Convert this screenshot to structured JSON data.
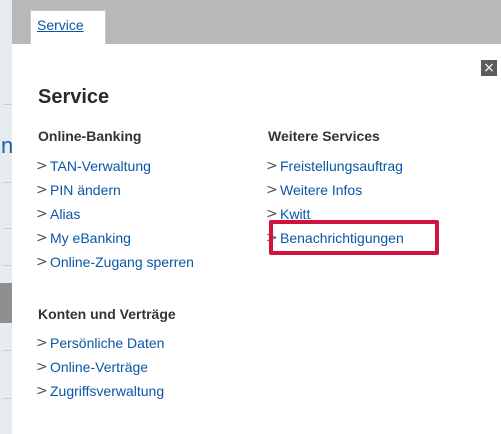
{
  "tabs": {
    "service_label": "Service"
  },
  "close": {
    "glyph": "×",
    "icon_name": "close-icon"
  },
  "panel": {
    "title": "Service",
    "columns": [
      {
        "title": "Online-Banking",
        "links": [
          "TAN-Verwaltung",
          "PIN ändern",
          "Alias",
          "My eBanking",
          "Online-Zugang sperren"
        ]
      },
      {
        "title": "Weitere Services",
        "links": [
          "Freistellungsauftrag",
          "Weitere Infos",
          "Kwitt",
          "Benachrichtigungen"
        ]
      },
      {
        "title": "Konten und Verträge",
        "links": [
          "Persönliche Daten",
          "Online-Verträge",
          "Zugriffsverwaltung"
        ]
      }
    ]
  },
  "background": {
    "fragment_glyph": "n"
  },
  "chevron_glyph": ">",
  "colors": {
    "link": "#0a56a6",
    "highlight": "#d0123f",
    "topbar": "#b7b8ba"
  }
}
